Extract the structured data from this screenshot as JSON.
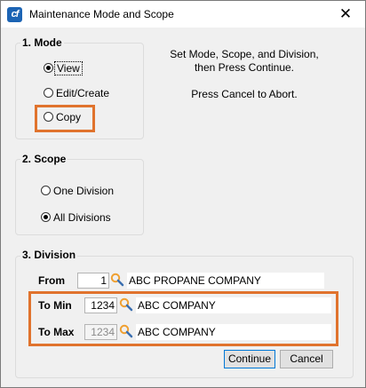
{
  "window": {
    "app_icon_text": "cf",
    "title": "Maintenance Mode and Scope",
    "close_glyph": "✕"
  },
  "mode": {
    "title": "1. Mode",
    "options": [
      {
        "label": "View",
        "checked": true
      },
      {
        "label": "Edit/Create",
        "checked": false
      },
      {
        "label": "Copy",
        "checked": false
      }
    ]
  },
  "instructions": {
    "line1": "Set Mode, Scope, and Division,",
    "line2": "then Press Continue.",
    "line3": "Press Cancel to Abort."
  },
  "scope": {
    "title": "2. Scope",
    "options": [
      {
        "label": "One Division",
        "checked": false
      },
      {
        "label": "All Divisions",
        "checked": true
      }
    ]
  },
  "division": {
    "title": "3. Division",
    "from": {
      "label": "From",
      "value": "1",
      "name": "ABC PROPANE COMPANY"
    },
    "to_min": {
      "label": "To Min",
      "value": "1234",
      "name": "ABC COMPANY"
    },
    "to_max": {
      "label": "To Max",
      "value": "1234",
      "name": "ABC COMPANY"
    }
  },
  "buttons": {
    "continue": "Continue",
    "cancel": "Cancel"
  },
  "colors": {
    "highlight": "#e0732d",
    "search_icon": "#f0a030"
  },
  "icons": {
    "search": "magnifier-icon",
    "close": "close-icon"
  }
}
